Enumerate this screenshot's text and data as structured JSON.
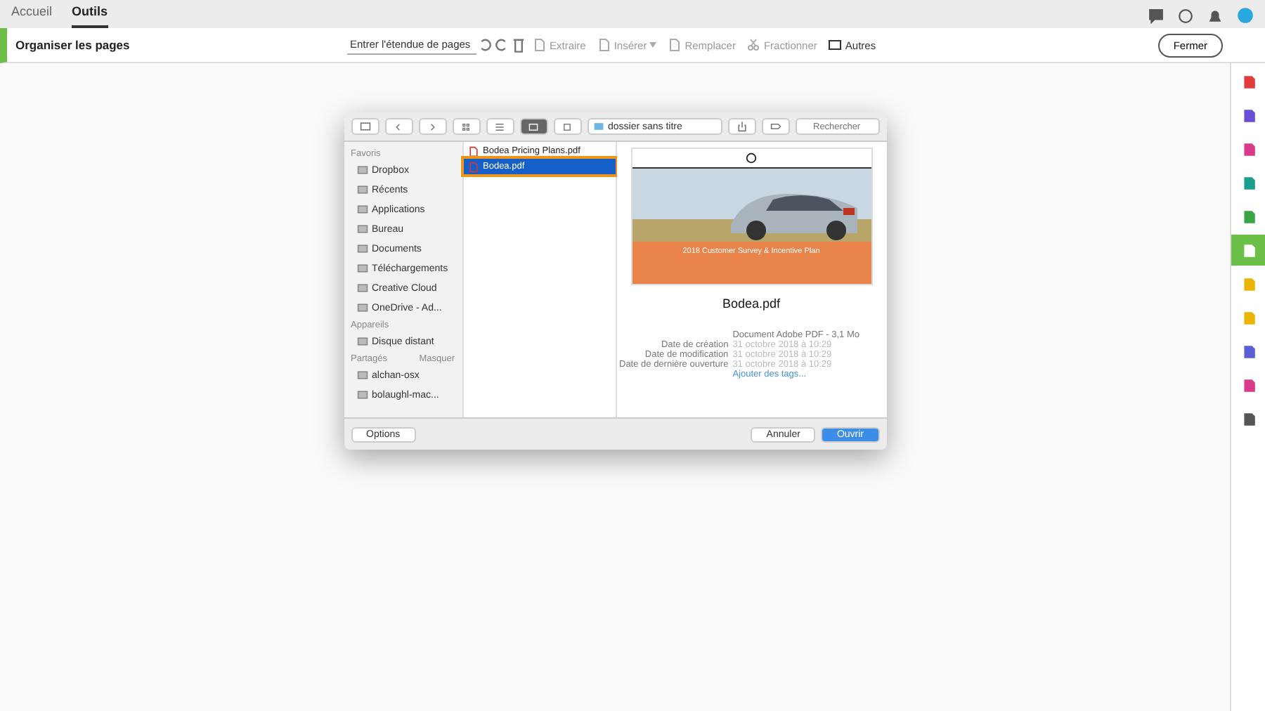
{
  "top_tabs": [
    {
      "label": "Accueil",
      "selected": false
    },
    {
      "label": "Outils",
      "selected": true
    }
  ],
  "toolbar": {
    "title": "Organiser les pages",
    "range_placeholder": "Entrer l'étendue de pages",
    "actions": [
      {
        "label": "Extraire",
        "kind": "page",
        "menu": false
      },
      {
        "label": "Insérer",
        "kind": "page",
        "menu": true
      },
      {
        "label": "Remplacer",
        "kind": "page",
        "menu": false
      },
      {
        "label": "Fractionner",
        "kind": "split",
        "menu": false
      }
    ],
    "more": "Autres",
    "close": "Fermer"
  },
  "right_tools": [
    {
      "color": "#e03c3c",
      "selected": false
    },
    {
      "color": "#6a4fd6",
      "selected": false
    },
    {
      "color": "#d93a8a",
      "selected": false
    },
    {
      "color": "#1a9e8f",
      "selected": false
    },
    {
      "color": "#3aa545",
      "selected": false
    },
    {
      "color": "#ffffff",
      "selected": true
    },
    {
      "color": "#e8b500",
      "selected": false
    },
    {
      "color": "#e8b500",
      "selected": false
    },
    {
      "color": "#5a5fd6",
      "selected": false
    },
    {
      "color": "#d93a8a",
      "selected": false
    },
    {
      "color": "#555555",
      "selected": false
    }
  ],
  "dialog": {
    "folder": "dossier sans titre",
    "search_placeholder": "Rechercher",
    "sidebar": [
      {
        "heading": "Favoris",
        "items": [
          "Dropbox",
          "Récents",
          "Applications",
          "Bureau",
          "Documents",
          "Téléchargements",
          "Creative Cloud",
          "OneDrive - Ad..."
        ]
      },
      {
        "heading": "Appareils",
        "items": [
          "Disque distant"
        ]
      },
      {
        "heading": "Partagés",
        "action": "Masquer",
        "items": [
          "alchan-osx",
          "bolaughl-mac..."
        ]
      }
    ],
    "files": [
      {
        "name": "Bodea Pricing Plans.pdf",
        "selected": false
      },
      {
        "name": "Bodea.pdf",
        "selected": true
      }
    ],
    "preview": {
      "doc_title": "2018 Customer Survey & Incentive Plan",
      "name": "Bodea.pdf",
      "kind": "Document Adobe PDF - 3,1 Mo",
      "meta": [
        {
          "label": "Date de création",
          "value": "31 octobre 2018 à 10:29"
        },
        {
          "label": "Date de modification",
          "value": "31 octobre 2018 à 10:29"
        },
        {
          "label": "Date de dernière ouverture",
          "value": "31 octobre 2018 à 10:29"
        }
      ],
      "tags": "Ajouter des tags..."
    },
    "options": "Options",
    "cancel": "Annuler",
    "open": "Ouvrir"
  }
}
